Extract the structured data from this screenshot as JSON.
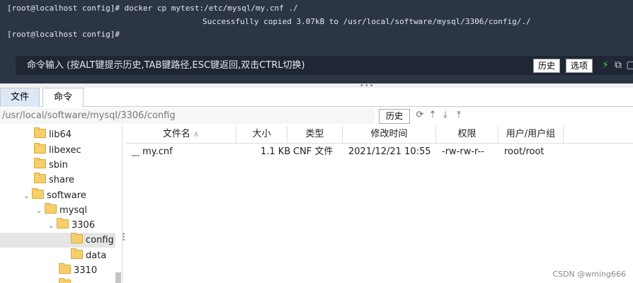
{
  "terminal": {
    "line1": "[root@localhost config]# docker cp mytest:/etc/mysql/my.cnf ./",
    "line2": "Successfully copied 3.07kB to /usr/local/software/mysql/3306/config/./",
    "line3": "[root@localhost config]#",
    "command_placeholder": "命令输入 (按ALT键提示历史,TAB键路径,ESC键返回,双击CTRL切换)",
    "history_button": "历史",
    "options_button": "选项"
  },
  "tabs": [
    "文件",
    "命令"
  ],
  "path_bar": {
    "path": "/usr/local/software/mysql/3306/config",
    "history_button": "历史"
  },
  "tree": [
    {
      "label": "lib64"
    },
    {
      "label": "libexec"
    },
    {
      "label": "sbin"
    },
    {
      "label": "share"
    },
    {
      "label": "software"
    },
    {
      "label": "mysql"
    },
    {
      "label": "3306"
    },
    {
      "label": "config"
    },
    {
      "label": "data"
    },
    {
      "label": "3310"
    }
  ],
  "file_list": {
    "headers": [
      "文件名",
      "大小",
      "类型",
      "修改时间",
      "权限",
      "用户/用户组"
    ],
    "rows": [
      {
        "name": "my.cnf",
        "size": "1.1 KB",
        "type": "CNF 文件",
        "modified": "2021/12/21 10:55",
        "permissions": "-rw-rw-r--",
        "owner": "root/root"
      }
    ]
  },
  "watermark": "CSDN @wming666",
  "colors": {
    "terminal_bg": "#2b3544",
    "accent_green": "#3ec43e",
    "folder": "#f6cf68"
  }
}
